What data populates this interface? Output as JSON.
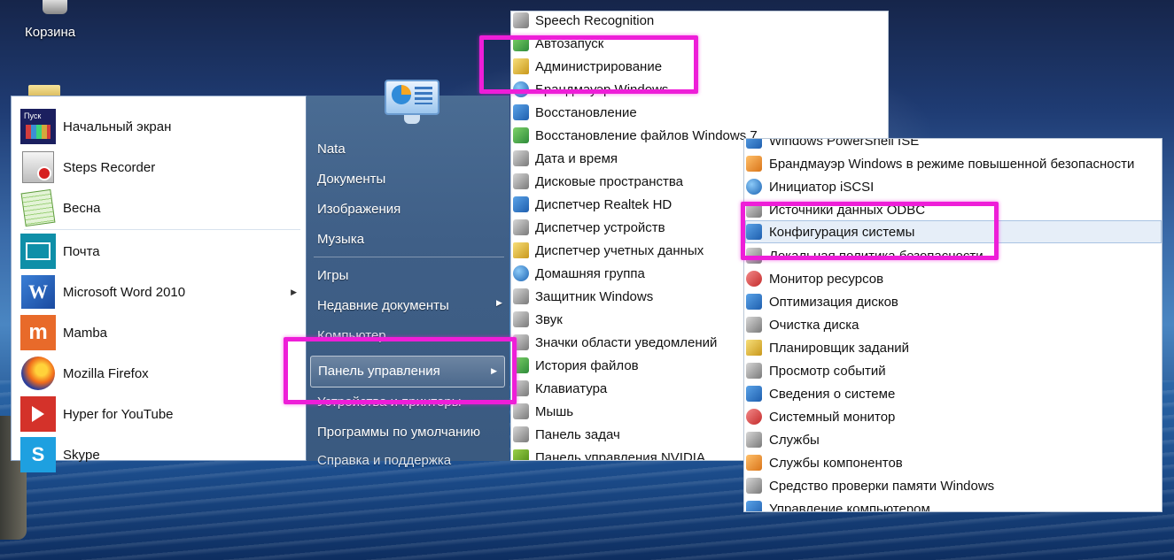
{
  "desktop": {
    "recycle_bin_label": "Корзина"
  },
  "start_menu": {
    "programs": [
      {
        "label": "Начальный экран",
        "icon": "start-screen-icon",
        "tile_text": "Пуск",
        "has_submenu": false
      },
      {
        "label": "Steps Recorder",
        "icon": "steps-recorder-icon",
        "has_submenu": false
      },
      {
        "label": "Весна",
        "icon": "notepad-icon",
        "has_submenu": false
      },
      {
        "label": "Почта",
        "icon": "mail-icon",
        "has_submenu": false
      },
      {
        "label": "Microsoft Word 2010",
        "icon": "word-icon",
        "tile_text": "W",
        "has_submenu": true
      },
      {
        "label": "Mamba",
        "icon": "mamba-icon",
        "tile_text": "m",
        "has_submenu": false
      },
      {
        "label": "Mozilla Firefox",
        "icon": "firefox-icon",
        "has_submenu": false
      },
      {
        "label": "Hyper for YouTube",
        "icon": "youtube-icon",
        "has_submenu": false
      },
      {
        "label": "Skype",
        "icon": "skype-icon",
        "tile_text": "S",
        "has_submenu": false
      }
    ],
    "places": [
      {
        "label": "Nata"
      },
      {
        "label": "Документы"
      },
      {
        "label": "Изображения"
      },
      {
        "label": "Музыка"
      },
      {
        "label": "Игры"
      },
      {
        "label": "Недавние документы",
        "has_submenu": true
      },
      {
        "label": "Компьютер"
      },
      {
        "label": "Панель управления",
        "has_submenu": true,
        "highlighted": true
      },
      {
        "label": "Устройства и принтеры"
      },
      {
        "label": "Программы по умолчанию"
      },
      {
        "label": "Справка и поддержка"
      }
    ]
  },
  "control_panel_list": {
    "items": [
      {
        "label": "Speech Recognition",
        "icon": "microphone-icon"
      },
      {
        "label": "Автозапуск",
        "icon": "autoplay-icon"
      },
      {
        "label": "Администрирование",
        "icon": "admin-tools-icon",
        "highlighted": true
      },
      {
        "label": "Брандмауэр Windows",
        "icon": "firewall-icon"
      },
      {
        "label": "Восстановление",
        "icon": "recovery-icon"
      },
      {
        "label": "Восстановление файлов Windows 7",
        "icon": "backup-icon"
      },
      {
        "label": "Дата и время",
        "icon": "clock-icon"
      },
      {
        "label": "Дисковые пространства",
        "icon": "storage-icon"
      },
      {
        "label": "Диспетчер Realtek HD",
        "icon": "realtek-icon"
      },
      {
        "label": "Диспетчер устройств",
        "icon": "device-manager-icon"
      },
      {
        "label": "Диспетчер учетных данных",
        "icon": "credential-icon"
      },
      {
        "label": "Домашняя группа",
        "icon": "homegroup-icon"
      },
      {
        "label": "Защитник Windows",
        "icon": "defender-icon"
      },
      {
        "label": "Звук",
        "icon": "sound-icon"
      },
      {
        "label": "Значки области уведомлений",
        "icon": "notification-icon"
      },
      {
        "label": "История файлов",
        "icon": "file-history-icon"
      },
      {
        "label": "Клавиатура",
        "icon": "keyboard-icon"
      },
      {
        "label": "Мышь",
        "icon": "mouse-icon"
      },
      {
        "label": "Панель задач",
        "icon": "taskbar-icon"
      },
      {
        "label": "Панель управления NVIDIA",
        "icon": "nvidia-icon"
      }
    ]
  },
  "admin_tools_list": {
    "items": [
      {
        "label": "Windows PowerShell ISE",
        "icon": "powershell-icon"
      },
      {
        "label": "Брандмауэр Windows в режиме повышенной безопасности",
        "icon": "firewall-advanced-icon"
      },
      {
        "label": "Инициатор iSCSI",
        "icon": "iscsi-icon"
      },
      {
        "label": "Источники данных ODBC",
        "icon": "odbc-icon"
      },
      {
        "label": "Конфигурация системы",
        "icon": "msconfig-icon",
        "selected": true,
        "highlighted": true
      },
      {
        "label": "Локальная политика безопасности",
        "icon": "security-policy-icon"
      },
      {
        "label": "Монитор ресурсов",
        "icon": "resource-monitor-icon"
      },
      {
        "label": "Оптимизация дисков",
        "icon": "defrag-icon"
      },
      {
        "label": "Очистка диска",
        "icon": "disk-cleanup-icon"
      },
      {
        "label": "Планировщик заданий",
        "icon": "task-scheduler-icon"
      },
      {
        "label": "Просмотр событий",
        "icon": "event-viewer-icon"
      },
      {
        "label": "Сведения о системе",
        "icon": "system-info-icon"
      },
      {
        "label": "Системный монитор",
        "icon": "performance-monitor-icon"
      },
      {
        "label": "Службы",
        "icon": "services-icon"
      },
      {
        "label": "Службы компонентов",
        "icon": "component-services-icon"
      },
      {
        "label": "Средство проверки памяти Windows",
        "icon": "memory-diagnostic-icon"
      },
      {
        "label": "Управление компьютером",
        "icon": "computer-management-icon"
      }
    ]
  },
  "colors": {
    "highlight": "#ee1ed8",
    "start_right_panel": "#3f5f87",
    "selection": "#e6eef8"
  }
}
